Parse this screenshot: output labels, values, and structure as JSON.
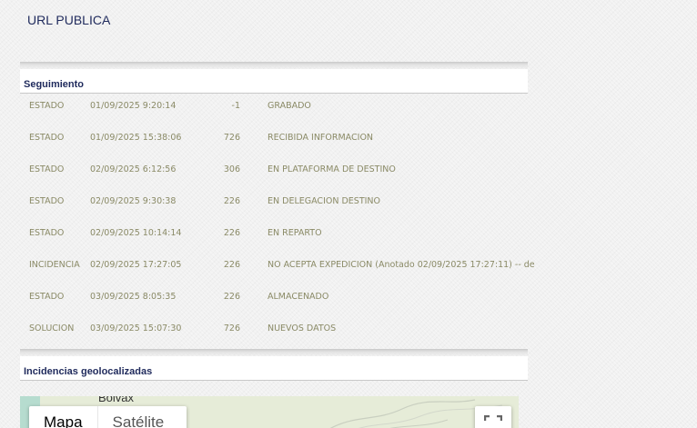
{
  "page": {
    "title": "URL PUBLICA"
  },
  "tracking": {
    "heading": "Seguimiento",
    "rows": [
      {
        "type": "ESTADO",
        "datetime": "01/09/2025 9:20:14",
        "code": "-1",
        "description": "GRABADO"
      },
      {
        "type": "ESTADO",
        "datetime": "01/09/2025 15:38:06",
        "code": "726",
        "description": "RECIBIDA INFORMACION"
      },
      {
        "type": "ESTADO",
        "datetime": "02/09/2025 6:12:56",
        "code": "306",
        "description": "EN PLATAFORMA DE DESTINO"
      },
      {
        "type": "ESTADO",
        "datetime": "02/09/2025 9:30:38",
        "code": "226",
        "description": "EN DELEGACION DESTINO"
      },
      {
        "type": "ESTADO",
        "datetime": "02/09/2025 10:14:14",
        "code": "226",
        "description": "EN REPARTO"
      },
      {
        "type": "INCIDENCIA",
        "datetime": "02/09/2025 17:27:05",
        "code": "226",
        "description": "NO ACEPTA EXPEDICION (Anotado 02/09/2025 17:27:11) -- de"
      },
      {
        "type": "ESTADO",
        "datetime": "03/09/2025 8:05:35",
        "code": "226",
        "description": "ALMACENADO"
      },
      {
        "type": "SOLUCION",
        "datetime": "03/09/2025 15:07:30",
        "code": "726",
        "description": "NUEVOS DATOS"
      }
    ]
  },
  "incidents": {
    "heading": "Incidencias geolocalizadas",
    "map": {
      "place_label": "Bolvax",
      "map_type_options": [
        "Mapa",
        "Satélite"
      ],
      "selected_map_type": "Mapa",
      "fullscreen_icon": "fullscreen-icon"
    }
  },
  "colors": {
    "heading_text": "#1f2a5c",
    "row_text": "#8a8a66",
    "map_land": "#e6ecd8",
    "map_water": "#b6dccf"
  }
}
